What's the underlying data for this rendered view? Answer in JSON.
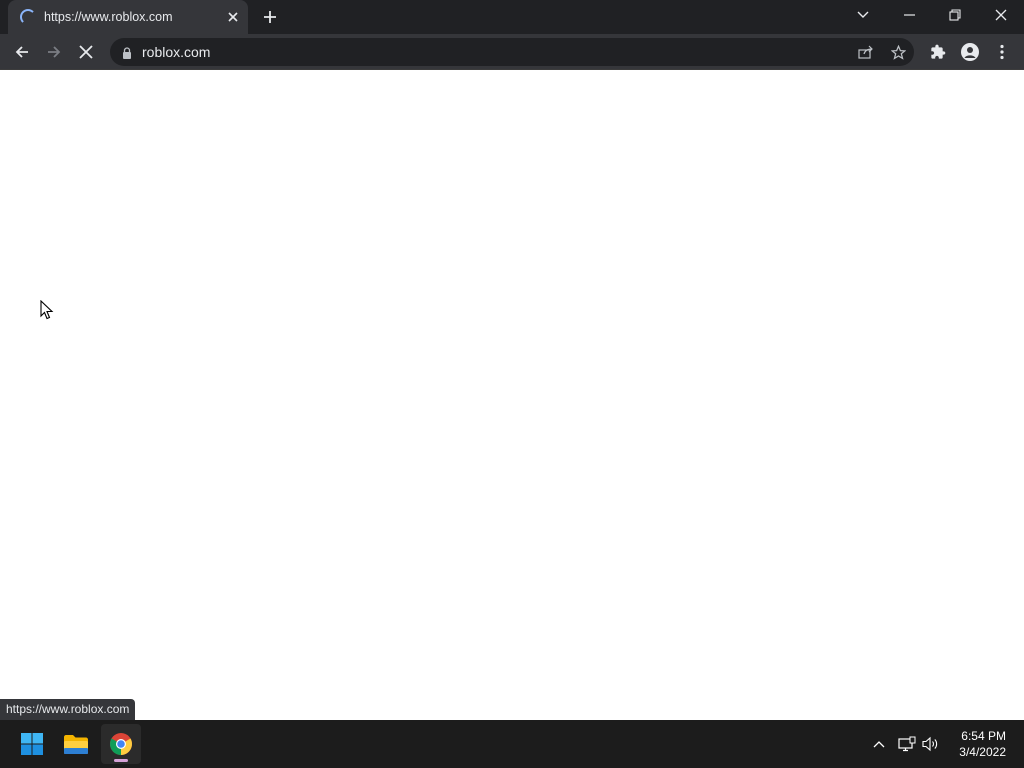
{
  "browser": {
    "tab": {
      "title": "https://www.roblox.com",
      "status_icon": "loading-spinner-icon"
    },
    "toolbar": {
      "url": "roblox.com",
      "icons": [
        "back-arrow-icon",
        "forward-arrow-icon",
        "stop-loading-icon",
        "lock-icon",
        "share-icon",
        "star-icon",
        "extensions-icon",
        "profile-icon",
        "menu-icon"
      ]
    },
    "status_bubble": "https://www.roblox.com",
    "colors": {
      "tab_strip": "#202124",
      "toolbar": "#35363a",
      "omnibox": "#202124",
      "spinner": "#8ab4f8"
    }
  },
  "taskbar": {
    "apps": [
      "windows-start-icon",
      "file-explorer-icon",
      "chrome-icon"
    ],
    "clock": {
      "time": "6:54 PM",
      "date": "3/4/2022"
    },
    "colors": {
      "background": "#1c1c1c",
      "active_indicator": "#d6a2d8"
    }
  }
}
